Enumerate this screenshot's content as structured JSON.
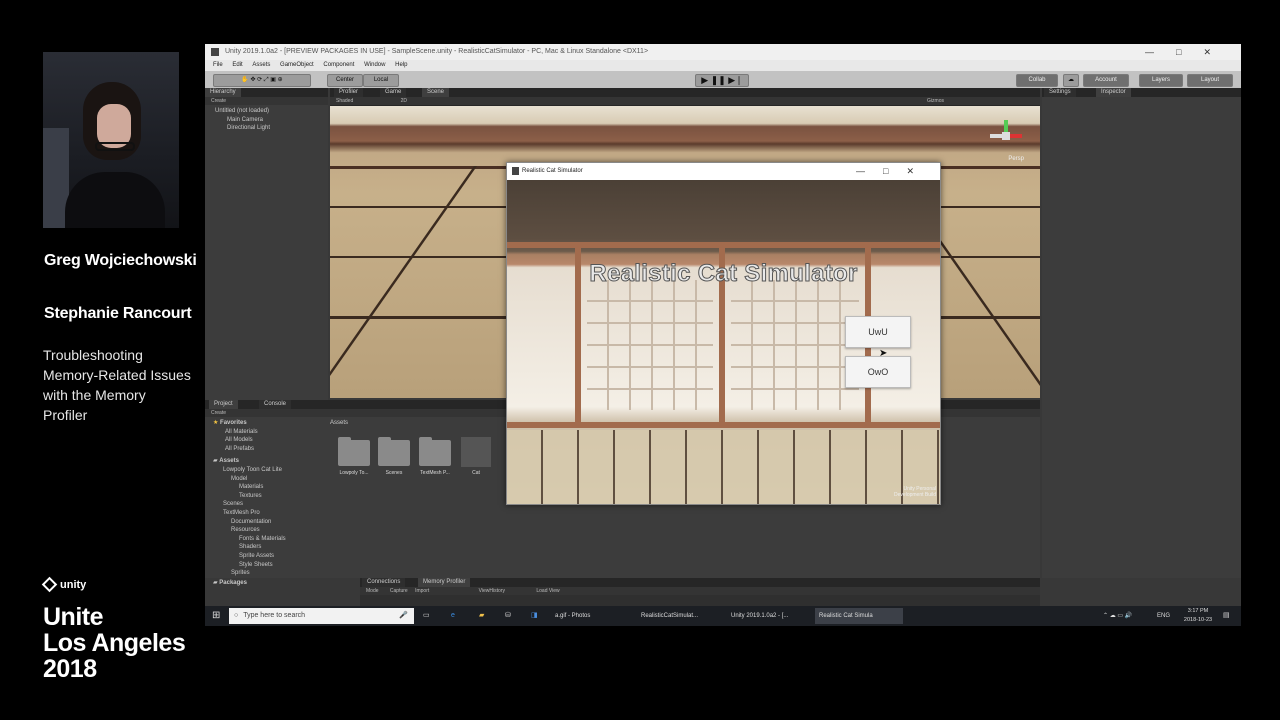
{
  "presenters": [
    "Greg Wojciechowski",
    "Stephanie Rancourt"
  ],
  "talk_title": "Troubleshooting Memory-Related Issues with the Memory Profiler",
  "brand": {
    "logo": "unity",
    "event": [
      "Unite",
      "Los Angeles",
      "2018"
    ]
  },
  "editor": {
    "window_title": "Unity 2019.1.0a2 - [PREVIEW PACKAGES IN USE] - SampleScene.unity - RealisticCatSimulator - PC, Mac & Linux Standalone <DX11>",
    "menu": [
      "File",
      "Edit",
      "Assets",
      "GameObject",
      "Component",
      "Window",
      "Help"
    ],
    "toolbar": {
      "pivot": "Center",
      "space": "Local",
      "collab": "Collab",
      "account": "Account",
      "layers": "Layers",
      "layout": "Layout"
    },
    "hierarchy": {
      "tab": "Hierarchy",
      "create": "Create",
      "items": [
        "Untitled (not loaded)",
        "Main Camera",
        "Directional Light"
      ]
    },
    "center_tabs": [
      "Profiler",
      "Game",
      "Scene"
    ],
    "scene_bar": {
      "shading": "Shaded",
      "mode2d": "2D",
      "gizmos": "Gizmos",
      "persp": "Persp"
    },
    "right_tabs": [
      "Settings",
      "Inspector"
    ],
    "project": {
      "tabs": [
        "Project",
        "Console"
      ],
      "create": "Create",
      "breadcrumb": "Assets",
      "favorites_label": "Favorites",
      "favorites": [
        "All Materials",
        "All Models",
        "All Prefabs"
      ],
      "assets_label": "Assets",
      "tree": [
        "Lowpoly Toon Cat Lite",
        "Model",
        "Materials",
        "Textures",
        "Scenes",
        "TextMesh Pro",
        "Documentation",
        "Resources",
        "Fonts & Materials",
        "Shaders",
        "Sprite Assets",
        "Style Sheets",
        "Sprites"
      ],
      "packages_label": "Packages",
      "grid": [
        "Lowpoly To...",
        "Scenes",
        "TextMesh P...",
        "Cat"
      ]
    },
    "bottom_tabs": [
      "Connections",
      "Memory Profiler"
    ],
    "memory_bar": [
      "Mode",
      "Capture",
      "Import",
      "ViewHistory",
      "Load View"
    ]
  },
  "game_window": {
    "title": "Realistic Cat Simulator",
    "heading": "Realistic Cat Simulator",
    "buttons": [
      "UwU",
      "OwO"
    ],
    "watermark": [
      "Unity Personal",
      "Development Build"
    ]
  },
  "taskbar": {
    "search_placeholder": "Type here to search",
    "apps": [
      "a.gif - Photos",
      "RealisticCatSimulat...",
      "Unity 2019.1.0a2 - [...",
      "Realistic Cat Simula"
    ],
    "lang": "ENG",
    "time": "3:17 PM",
    "date": "2018-10-23"
  }
}
